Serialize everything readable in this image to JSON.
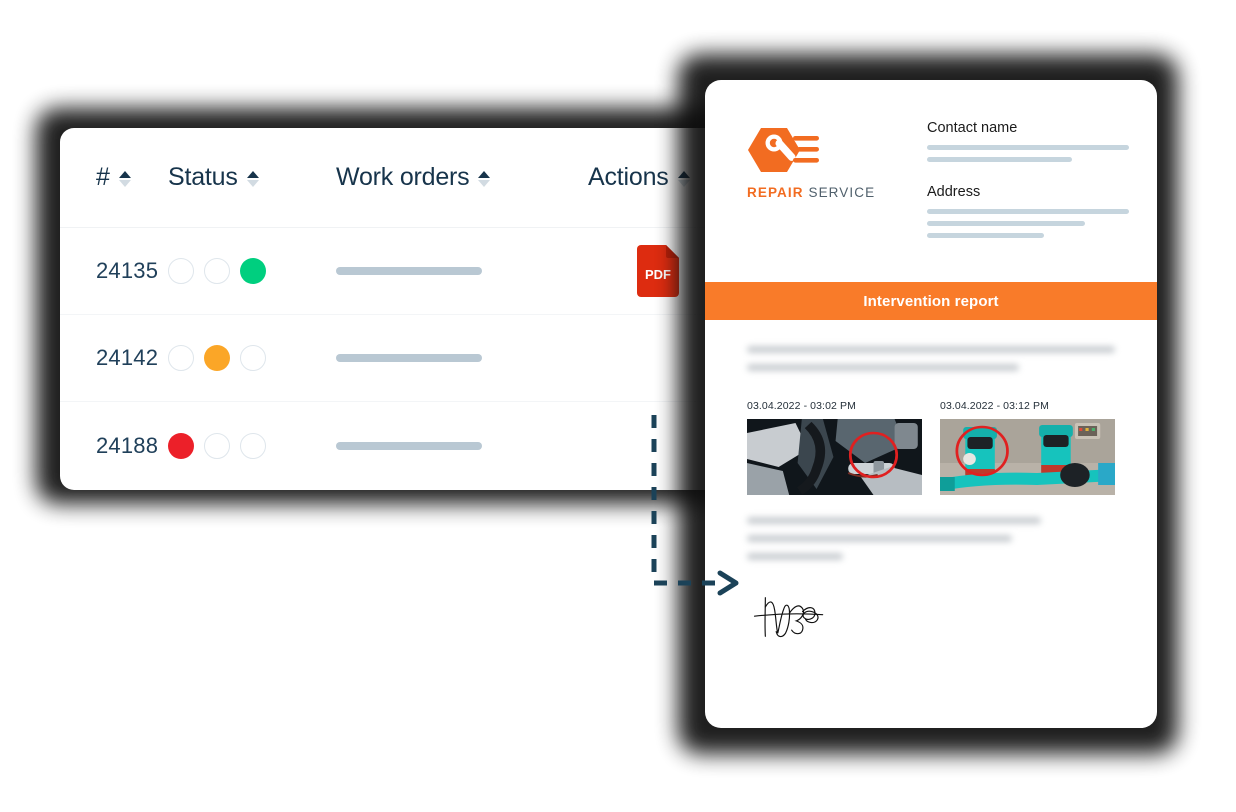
{
  "table": {
    "columns": [
      {
        "label": "#",
        "sortable": true,
        "name": "id"
      },
      {
        "label": "Status",
        "sortable": true,
        "name": "status"
      },
      {
        "label": "Work orders",
        "sortable": true,
        "name": "work-orders"
      },
      {
        "label": "Actions",
        "sortable": true,
        "name": "actions"
      }
    ],
    "rows": [
      {
        "id": "24135",
        "status_index": 2,
        "status_color": "#00cf7f",
        "status_name": "complete",
        "action_icon": "pdf-icon",
        "action_label": "PDF"
      },
      {
        "id": "24142",
        "status_index": 1,
        "status_color": "#fba627",
        "status_name": "in-progress",
        "action_icon": null,
        "action_label": ""
      },
      {
        "id": "24188",
        "status_index": 0,
        "status_color": "#ec2029",
        "status_name": "urgent",
        "action_icon": null,
        "action_label": ""
      }
    ],
    "status_dot_count": 3,
    "empty_dot_color": "#ffffff",
    "empty_dot_border": "#dfe6ec",
    "placeholder_bar_color": "#b9c8d3"
  },
  "report": {
    "logo": {
      "icon": "wrench-hexagon-icon",
      "word_primary": "REPAIR",
      "word_secondary": "SERVICE",
      "primary_color": "#f26c21",
      "secondary_color": "#50606c"
    },
    "fields": [
      {
        "label": "Contact name",
        "line_widths": [
          "100%",
          "72%"
        ]
      },
      {
        "label": "Address",
        "line_widths": [
          "100%",
          "78%",
          "58%"
        ]
      }
    ],
    "banner": {
      "text": "Intervention report",
      "background": "#f97b29",
      "text_color": "#ffffff"
    },
    "body_paragraph_1_lines": [
      "100%",
      "74%"
    ],
    "body_paragraph_2_lines": [
      "80%",
      "72%",
      "26%"
    ],
    "photos": [
      {
        "timestamp": "03.04.2022 - 03:02 PM",
        "subject": "engine-bay-photo",
        "annotation": "red-circle-annotation"
      },
      {
        "timestamp": "03.04.2022 - 03:12 PM",
        "subject": "industrial-pump-photo",
        "annotation": "red-circle-annotation"
      }
    ],
    "signature": {
      "name": "signature-mark"
    }
  },
  "connector": {
    "name": "dashed-flow-arrow",
    "color": "#1b4258",
    "style": "dashed"
  }
}
